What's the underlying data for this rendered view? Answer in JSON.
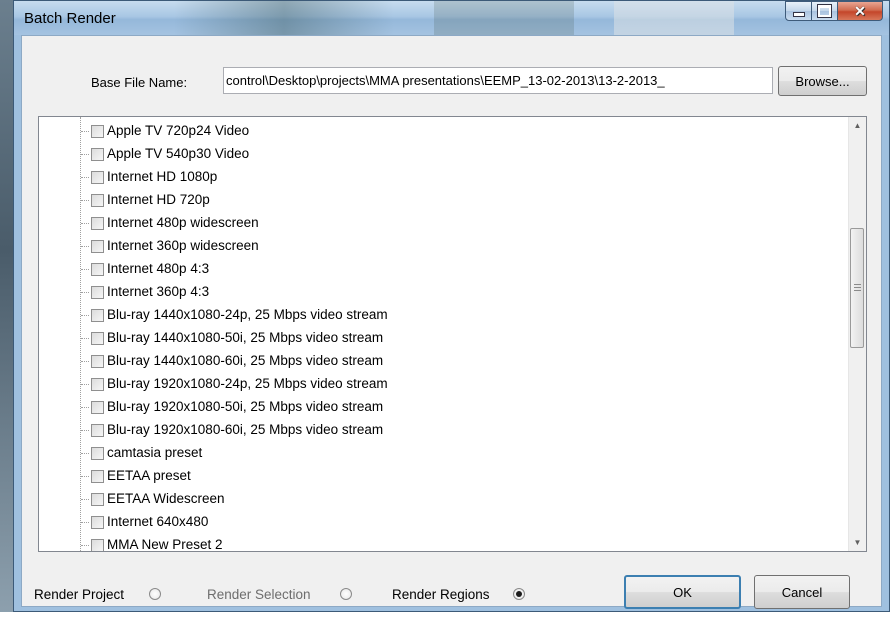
{
  "window": {
    "title": "Batch Render"
  },
  "base_file": {
    "label": "Base File Name:",
    "value": "control\\Desktop\\projects\\MMA presentations\\EEMP_13-02-2013\\13-2-2013_"
  },
  "buttons": {
    "browse": "Browse...",
    "ok": "OK",
    "cancel": "Cancel"
  },
  "templates": [
    "Apple TV 720p24 Video",
    "Apple TV 540p30 Video",
    "Internet HD 1080p",
    "Internet HD 720p",
    "Internet 480p widescreen",
    "Internet 360p widescreen",
    "Internet 480p 4:3",
    "Internet 360p 4:3",
    "Blu-ray 1440x1080-24p, 25 Mbps video stream",
    "Blu-ray 1440x1080-50i, 25 Mbps video stream",
    "Blu-ray 1440x1080-60i, 25 Mbps video stream",
    "Blu-ray 1920x1080-24p, 25 Mbps video stream",
    "Blu-ray 1920x1080-50i, 25 Mbps video stream",
    "Blu-ray 1920x1080-60i, 25 Mbps video stream",
    "camtasia preset",
    "EETAA preset",
    "EETAA Widescreen",
    "Internet 640x480",
    "MMA New Preset 2"
  ],
  "render_options": {
    "project": {
      "label": "Render Project",
      "checked": false,
      "enabled": true
    },
    "selection": {
      "label": "Render Selection",
      "checked": false,
      "enabled": false
    },
    "regions": {
      "label": "Render Regions",
      "checked": true,
      "enabled": true
    }
  },
  "caption": {
    "minimize": "minimize-icon",
    "maximize": "maximize-icon",
    "close": "close-icon"
  }
}
